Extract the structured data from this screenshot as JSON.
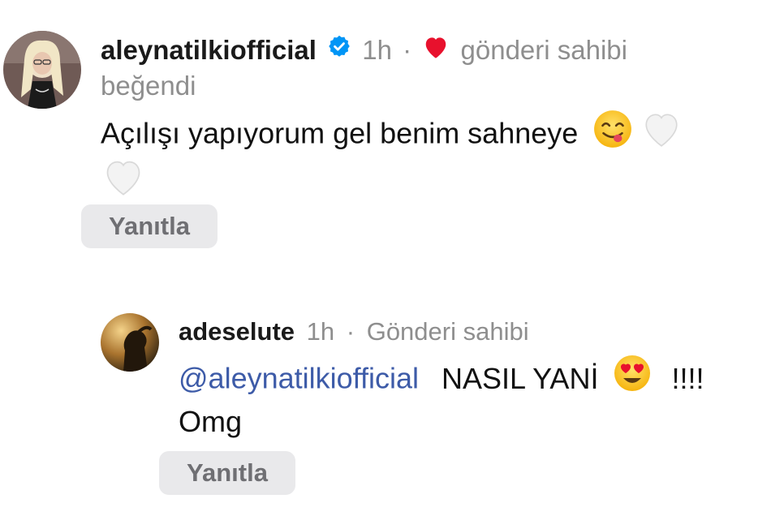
{
  "comment": {
    "username": "aleynatilkiofficial",
    "time": "1h",
    "separator": "·",
    "liked_by_owner_a": "gönderi sahibi",
    "liked_by_owner_b": "beğendi",
    "text": "Açılışı yapıyorum gel benim sahneye",
    "reply_label": "Yanıtla",
    "heart_color": "#e8112d",
    "verified_color": "#0095f6"
  },
  "reply": {
    "username": "adeselute",
    "time": "1h",
    "separator": "·",
    "owner_label": "Gönderi sahibi",
    "mention": "@aleynatilkiofficial",
    "text": "NASIL YANİ",
    "exclamation": "!!!!",
    "text_line2": "Omg",
    "reply_label": "Yanıtla"
  }
}
